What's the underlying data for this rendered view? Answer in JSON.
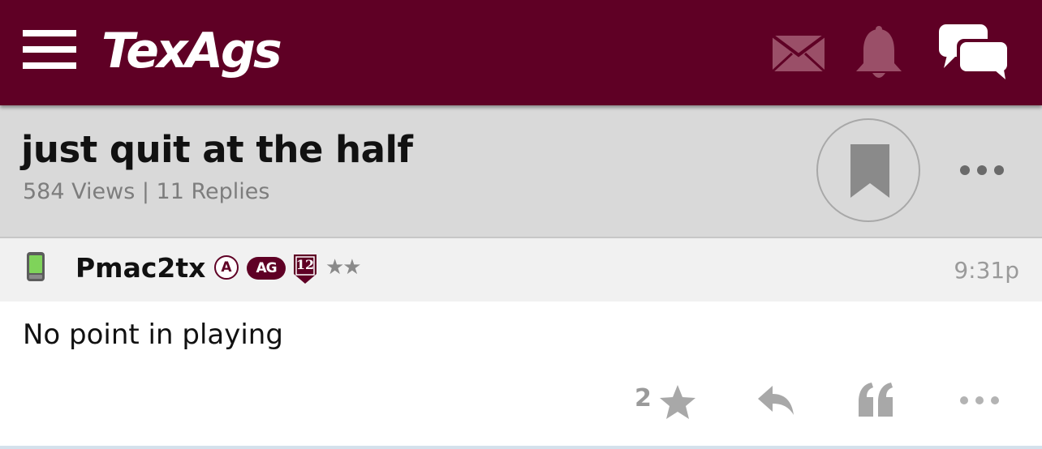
{
  "app": {
    "logo_text": "TexAgs",
    "brand_color": "#5f0025",
    "icons": [
      "menu-icon",
      "mail-icon",
      "bell-icon",
      "chat-icon"
    ]
  },
  "thread": {
    "title": "just quit at the half",
    "meta": "584 Views | 11 Replies",
    "icons": [
      "bookmark-icon",
      "more-options-icon"
    ]
  },
  "post": {
    "username": "Pmac2tx",
    "badges": {
      "a": "A",
      "ag": "AG",
      "number": "12",
      "rank_stars": "★★"
    },
    "time": "9:31p",
    "body": "No point in playing",
    "star_count": "2",
    "icons": [
      "phone-icon",
      "star-icon",
      "reply-icon",
      "quote-icon",
      "more-options-icon"
    ]
  }
}
